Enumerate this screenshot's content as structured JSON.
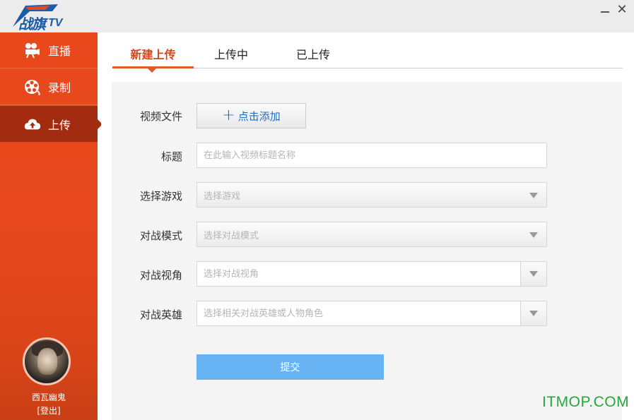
{
  "app": {
    "logo_main": "战旗",
    "logo_suffix": "TV"
  },
  "window": {
    "close_label": "✕"
  },
  "sidebar": {
    "items": [
      {
        "label": "直播",
        "icon": "camera-icon"
      },
      {
        "label": "录制",
        "icon": "film-reel-icon"
      },
      {
        "label": "上传",
        "icon": "cloud-upload-icon"
      }
    ],
    "active_index": 2,
    "user": {
      "name": "西瓦幽鬼",
      "logout": "[登出]"
    }
  },
  "tabs": [
    {
      "label": "新建上传",
      "active": true
    },
    {
      "label": "上传中",
      "active": false
    },
    {
      "label": "已上传",
      "active": false
    }
  ],
  "form": {
    "video_file": {
      "label": "视频文件",
      "button": "点击添加"
    },
    "title": {
      "label": "标题",
      "placeholder": "在此输入视频标题名称"
    },
    "game": {
      "label": "选择游戏",
      "placeholder": "选择游戏"
    },
    "mode": {
      "label": "对战模式",
      "placeholder": "选择对战模式"
    },
    "view": {
      "label": "对战视角",
      "placeholder": "选择对战视角"
    },
    "hero": {
      "label": "对战英雄",
      "placeholder": "选择相关对战英雄或人物角色"
    },
    "submit": "提交"
  },
  "watermark": "ITMOP.COM",
  "colors": {
    "accent": "#e8481c",
    "active_nav": "#a32c10",
    "submit": "#68b3f4",
    "link": "#1d6cc6"
  }
}
